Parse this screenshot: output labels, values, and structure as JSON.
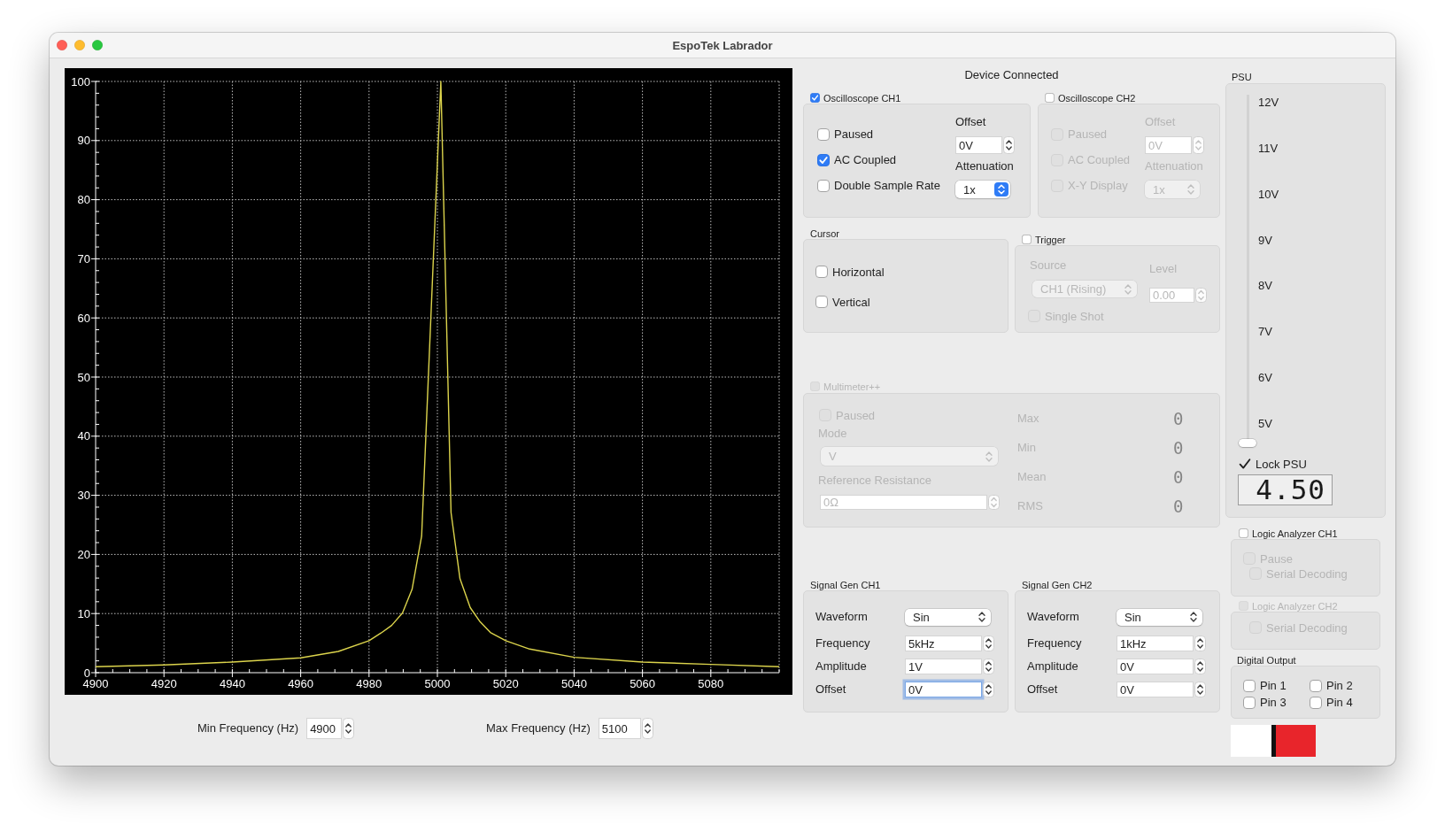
{
  "window": {
    "title": "EspoTek Labrador"
  },
  "plot": {
    "chart_data": {
      "type": "line",
      "grid": true,
      "x": [
        4900,
        4920,
        4940,
        4960,
        4971,
        4980,
        4983.5,
        4986.6,
        4989.8,
        4992.6,
        4995.4,
        5001,
        5004,
        5006.6,
        5009.6,
        5012.5,
        5015.5,
        5020,
        5027,
        5040,
        5060,
        5080,
        5100
      ],
      "series": [
        {
          "color": "#dcd44c",
          "values": [
            1.0,
            1.3,
            1.8,
            2.5,
            3.6,
            5.4,
            6.7,
            8.0,
            10.1,
            14.1,
            23.1,
            100,
            27.1,
            15.9,
            11.0,
            8.6,
            6.8,
            5.4,
            4.0,
            2.6,
            1.8,
            1.4,
            1.0
          ]
        }
      ],
      "xlim": [
        4900,
        5100
      ],
      "ylim": [
        0,
        100
      ],
      "xticks": [
        4900,
        4920,
        4940,
        4960,
        4980,
        5000,
        5020,
        5040,
        5060,
        5080
      ],
      "yticks": [
        0,
        10,
        20,
        30,
        40,
        50,
        60,
        70,
        80,
        90,
        100
      ]
    }
  },
  "frequency_range": [
    {
      "label": "Min Frequency (Hz)",
      "value": "4900"
    },
    {
      "label": "Max Frequency (Hz)",
      "value": "5100"
    }
  ],
  "status": "Device Connected",
  "oscilloscopes": [
    {
      "title": "Oscilloscope CH1",
      "checked": true,
      "disabled": false,
      "options": [
        {
          "label": "Paused",
          "checked": false
        },
        {
          "label": "AC Coupled",
          "checked": true
        },
        {
          "label": "Double Sample Rate",
          "checked": false
        }
      ],
      "offset_label": "Offset",
      "offset": "0V",
      "attenuation_label": "Attenuation",
      "attenuation": "1x"
    },
    {
      "title": "Oscilloscope CH2",
      "checked": false,
      "disabled": false,
      "options": [
        {
          "label": "Paused",
          "checked": false
        },
        {
          "label": "AC Coupled",
          "checked": false
        },
        {
          "label": "X-Y Display",
          "checked": false
        }
      ],
      "offset_label": "Offset",
      "offset": "0V",
      "attenuation_label": "Attenuation",
      "attenuation": "1x"
    }
  ],
  "cursor": {
    "title": "Cursor",
    "options": [
      {
        "label": "Horizontal",
        "checked": false
      },
      {
        "label": "Vertical",
        "checked": false
      }
    ]
  },
  "trigger": {
    "title": "Trigger",
    "checked": false,
    "source_label": "Source",
    "source": "CH1 (Rising)",
    "threshold_label": "Level",
    "threshold": "0.00",
    "single_shot": {
      "label": "Single Shot",
      "checked": false
    }
  },
  "multimeter": {
    "title": "Multimeter++",
    "checked": false,
    "disabled": true,
    "paused": {
      "label": "Paused",
      "checked": false
    },
    "mode_label": "Mode",
    "mode": "V",
    "resistance_label": "Reference Resistance",
    "resistance": "0Ω",
    "readings": [
      {
        "label": "Max",
        "value": "0"
      },
      {
        "label": "Min",
        "value": "0"
      },
      {
        "label": "Mean",
        "value": "0"
      },
      {
        "label": "RMS",
        "value": "0"
      }
    ]
  },
  "signal_generators": [
    {
      "title": "Signal Gen CH1",
      "waveform_label": "Waveform",
      "waveform": "Sin",
      "fields": [
        {
          "label": "Frequency",
          "value": "5kHz",
          "focused": false
        },
        {
          "label": "Amplitude",
          "value": "1V",
          "focused": false
        },
        {
          "label": "Offset",
          "value": "0V",
          "focused": true
        }
      ]
    },
    {
      "title": "Signal Gen CH2",
      "waveform_label": "Waveform",
      "waveform": "Sin",
      "fields": [
        {
          "label": "Frequency",
          "value": "1kHz",
          "focused": false
        },
        {
          "label": "Amplitude",
          "value": "0V",
          "focused": false
        },
        {
          "label": "Offset",
          "value": "0V",
          "focused": false
        }
      ]
    }
  ],
  "psu": {
    "title": "PSU",
    "scale": [
      "12V",
      "11V",
      "10V",
      "9V",
      "8V",
      "7V",
      "6V",
      "5V"
    ],
    "level": 0,
    "lock": {
      "label": "Lock PSU",
      "checked": true
    },
    "display": "4.50"
  },
  "logic_analyzers": [
    {
      "title": "Logic Analyzer CH1",
      "checked": false,
      "disabled": false,
      "options": [
        {
          "label": "Pause",
          "checked": false,
          "kind": "main"
        },
        {
          "label": "Serial Decoding",
          "checked": false,
          "kind": "sub"
        }
      ]
    },
    {
      "title": "Logic Analyzer CH2",
      "checked": false,
      "disabled": true,
      "options": [
        {
          "label": "Serial Decoding",
          "checked": false,
          "kind": "sub"
        }
      ]
    }
  ],
  "digital_output": {
    "title": "Digital Output",
    "pins": [
      {
        "label": "Pin 1",
        "checked": false
      },
      {
        "label": "Pin 2",
        "checked": false
      },
      {
        "label": "Pin 3",
        "checked": false
      },
      {
        "label": "Pin 4",
        "checked": false
      }
    ]
  }
}
